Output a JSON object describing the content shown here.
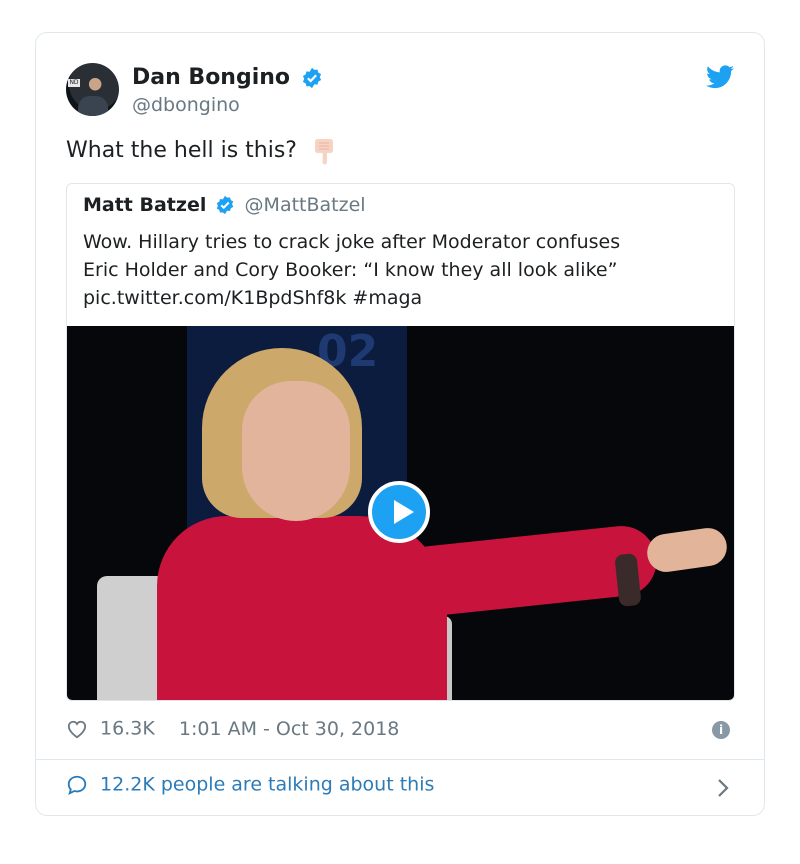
{
  "tweet": {
    "author": {
      "display_name": "Dan Bongino",
      "handle": "@dbongino",
      "verified": true,
      "avatar_icon": "avatar-photo"
    },
    "text": "What the hell is this?",
    "emoji": "backhand-index-pointing-down",
    "quoted": {
      "author_name": "Matt Batzel",
      "author_handle": "@MattBatzel",
      "verified": true,
      "text": "Wow. Hillary tries to crack joke after Moderator confuses\nEric Holder and Cory Booker: “I know they all look alike”\npic.twitter.com/K1BpdShf8k #maga",
      "media": {
        "type": "video",
        "background_number": "02"
      }
    },
    "likes": "16.3K",
    "timestamp": "1:01 AM - Oct 30, 2018",
    "talking_label": "12.2K people are talking about this"
  },
  "icons": [
    "twitter-bird-icon",
    "verified-badge-icon",
    "heart-icon",
    "info-icon",
    "speech-bubble-icon",
    "chevron-right-icon",
    "play-icon"
  ],
  "colors": {
    "brand": "#1da1f2",
    "link": "#2b7bb9",
    "muted": "#697882",
    "border": "#e1e8ed"
  }
}
